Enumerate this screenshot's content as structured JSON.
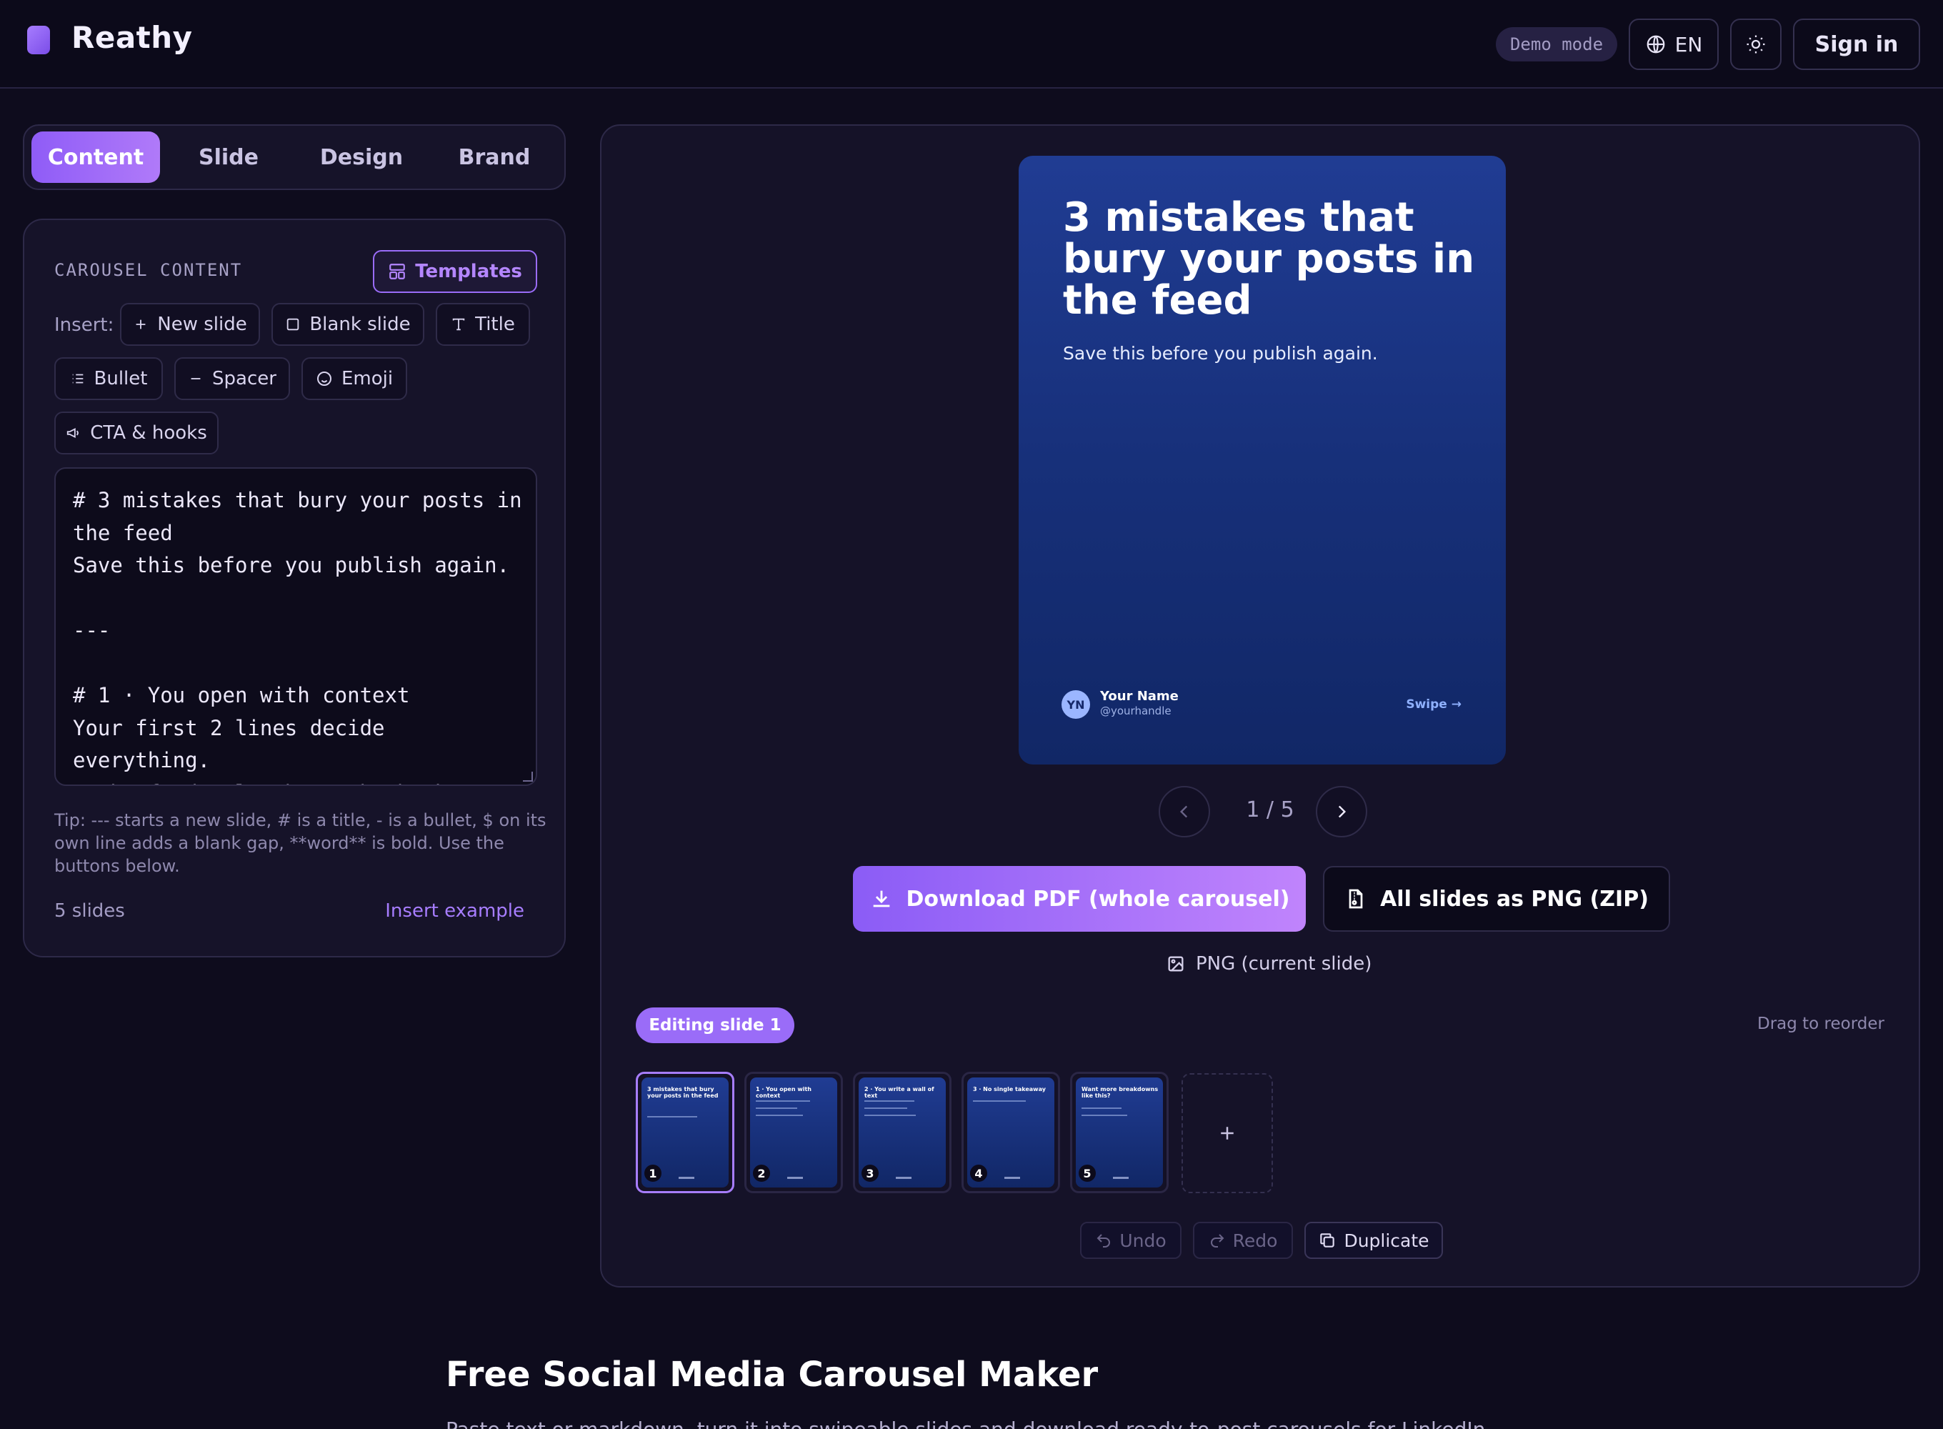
{
  "app": {
    "name": "Reathy",
    "demo_label": "Demo mode",
    "language": "EN",
    "sign_in": "Sign in"
  },
  "tabs": [
    {
      "label": "Content",
      "active": true
    },
    {
      "label": "Slide",
      "active": false
    },
    {
      "label": "Design",
      "active": false
    },
    {
      "label": "Brand",
      "active": false
    }
  ],
  "content_panel": {
    "section_label": "CAROUSEL CONTENT",
    "templates_button": "Templates",
    "insert_label": "Insert:",
    "insert_buttons": {
      "new_slide": "New slide",
      "blank_slide": "Blank slide",
      "title": "Title",
      "bullet": "Bullet",
      "spacer": "Spacer",
      "emoji": "Emoji",
      "cta": "CTA & hooks"
    },
    "editor_text": "# 3 mistakes that bury your posts in the feed\nSave this before you publish again.\n\n---\n\n# 1 · You open with context\nYour first 2 lines decide everything.\n- The feed only shows the hook",
    "tip": "Tip: --- starts a new slide, # is a title, - is a bullet, $ on its own line adds a blank gap, **word** is bold. Use the buttons below.",
    "slides_count": "5 slides",
    "insert_example": "Insert example"
  },
  "preview": {
    "slide_title": "3 mistakes that bury your posts in the feed",
    "slide_subtitle": "Save this before you publish again.",
    "avatar_initials": "YN",
    "author_name": "Your Name",
    "author_handle": "@yourhandle",
    "swipe_label": "Swipe →",
    "counter": "1 / 5",
    "download_pdf": "Download PDF (whole carousel)",
    "download_zip": "All slides as PNG (ZIP)",
    "png_current": "PNG (current slide)",
    "editing_badge": "Editing slide 1",
    "drag_hint": "Drag to reorder",
    "thumbnails": [
      {
        "number": "1",
        "title": "3 mistakes that bury your posts in the feed",
        "active": true
      },
      {
        "number": "2",
        "title": "1 · You open with context",
        "active": false
      },
      {
        "number": "3",
        "title": "2 · You write a wall of text",
        "active": false
      },
      {
        "number": "4",
        "title": "3 · No single takeaway",
        "active": false
      },
      {
        "number": "5",
        "title": "Want more breakdowns like this?",
        "active": false
      }
    ],
    "undo": "Undo",
    "redo": "Redo",
    "duplicate": "Duplicate"
  },
  "page": {
    "heading": "Free Social Media Carousel Maker",
    "intro": "Paste text or markdown, turn it into swipeable slides and download ready-to-post carousels for LinkedIn."
  },
  "colors": {
    "background": "#0e0c1d",
    "accent": "#a77dff",
    "slide_gradient_top": "#203c93",
    "slide_gradient_bottom": "#112766"
  },
  "icons": [
    "globe-icon",
    "sun-icon",
    "layout-icon",
    "plus-icon",
    "square-icon",
    "type-icon",
    "list-icon",
    "minus-icon",
    "smile-icon",
    "megaphone-icon",
    "chevron-left-icon",
    "chevron-right-icon",
    "download-icon",
    "file-zip-icon",
    "image-icon",
    "undo-icon",
    "redo-icon",
    "copy-icon"
  ]
}
